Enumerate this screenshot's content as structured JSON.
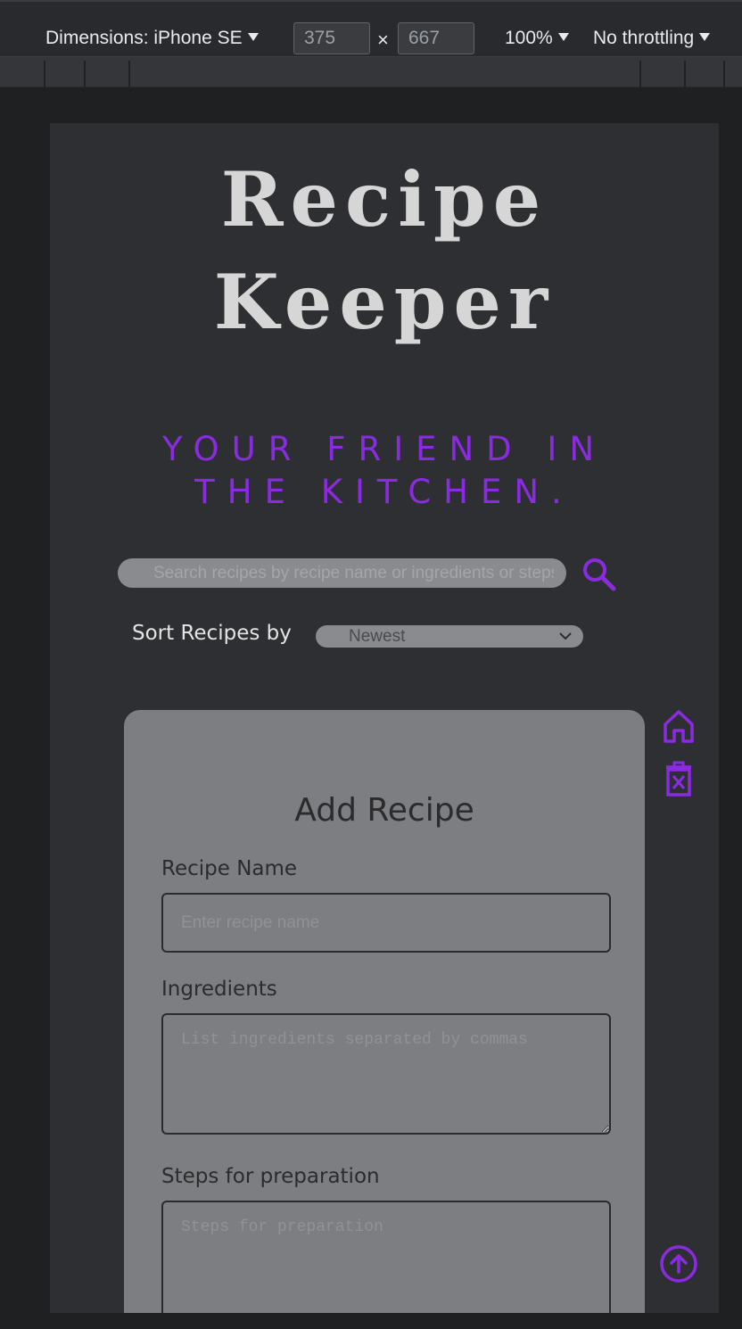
{
  "devtools": {
    "dimensions_label": "Dimensions: iPhone SE",
    "width_value": "375",
    "height_value": "667",
    "times": "×",
    "zoom": "100%",
    "throttling": "No throttling"
  },
  "app": {
    "title_line1": "Recipe",
    "title_line2": "Keeper",
    "tagline": "YOUR FRIEND IN THE KITCHEN.",
    "accent_color": "#8a2be2"
  },
  "search": {
    "placeholder": "Search recipes by recipe name or ingredients or steps"
  },
  "sort": {
    "label": "Sort Recipes by",
    "selected": "Newest"
  },
  "add_recipe": {
    "title": "Add Recipe",
    "name_label": "Recipe Name",
    "name_placeholder": "Enter recipe name",
    "ingredients_label": "Ingredients",
    "ingredients_placeholder": "List ingredients separated by commas",
    "steps_label": "Steps for preparation",
    "steps_placeholder": "Steps for preparation"
  },
  "icons": {
    "home": "home-icon",
    "delete": "trash-x-icon",
    "scroll_top": "arrow-up-circle-icon",
    "search": "search-icon"
  }
}
